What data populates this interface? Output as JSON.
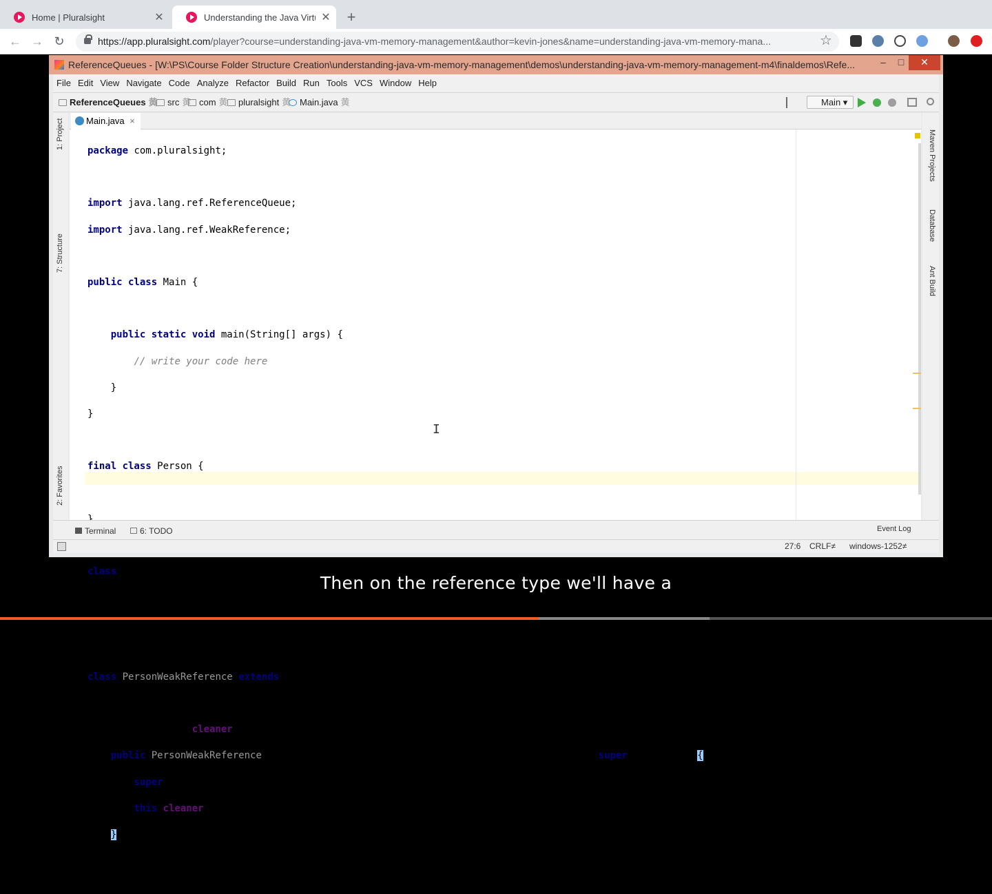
{
  "browser": {
    "tabs": [
      {
        "title": "Home | Pluralsight",
        "active": false
      },
      {
        "title": "Understanding the Java Virtual Machine",
        "active": true
      }
    ],
    "url_host": "https://app.pluralsight.com",
    "url_path": "/player?course=understanding-java-vm-memory-management&author=kevin-jones&name=understanding-java-vm-memory-mana...",
    "new_tab_glyph": "+",
    "close_glyph": "✕"
  },
  "ide": {
    "window_title": "ReferenceQueues - [W:\\PS\\Course Folder Structure Creation\\understanding-java-vm-memory-management\\demos\\understanding-java-vm-memory-management-m4\\finaldemos\\Refe...",
    "menu": [
      "File",
      "Edit",
      "View",
      "Navigate",
      "Code",
      "Analyze",
      "Refactor",
      "Build",
      "Run",
      "Tools",
      "VCS",
      "Window",
      "Help"
    ],
    "breadcrumbs": [
      "ReferenceQueues",
      "src",
      "com",
      "pluralsight",
      "Main.java"
    ],
    "run_config": "Main",
    "editor_tab": "Main.java",
    "editor_tab_close": "×",
    "left_tools": [
      "1: Project",
      "7: Structure",
      "2: Favorites"
    ],
    "right_tools": [
      "Maven Projects",
      "Database",
      "Ant Build"
    ],
    "bottom_tools": [
      "Terminal",
      "6: TODO"
    ],
    "event_log": "Event Log",
    "status": {
      "position": "27:6",
      "line_sep": "CRLF≠",
      "encoding": "windows-1252≠"
    }
  },
  "caption": "Then on the reference type we'll have a",
  "playback": {
    "progress_fraction": 0.543,
    "buffered_fraction": 0.715
  },
  "colors": {
    "accent": "#f15b2a",
    "title_bar": "#e4a58e"
  }
}
